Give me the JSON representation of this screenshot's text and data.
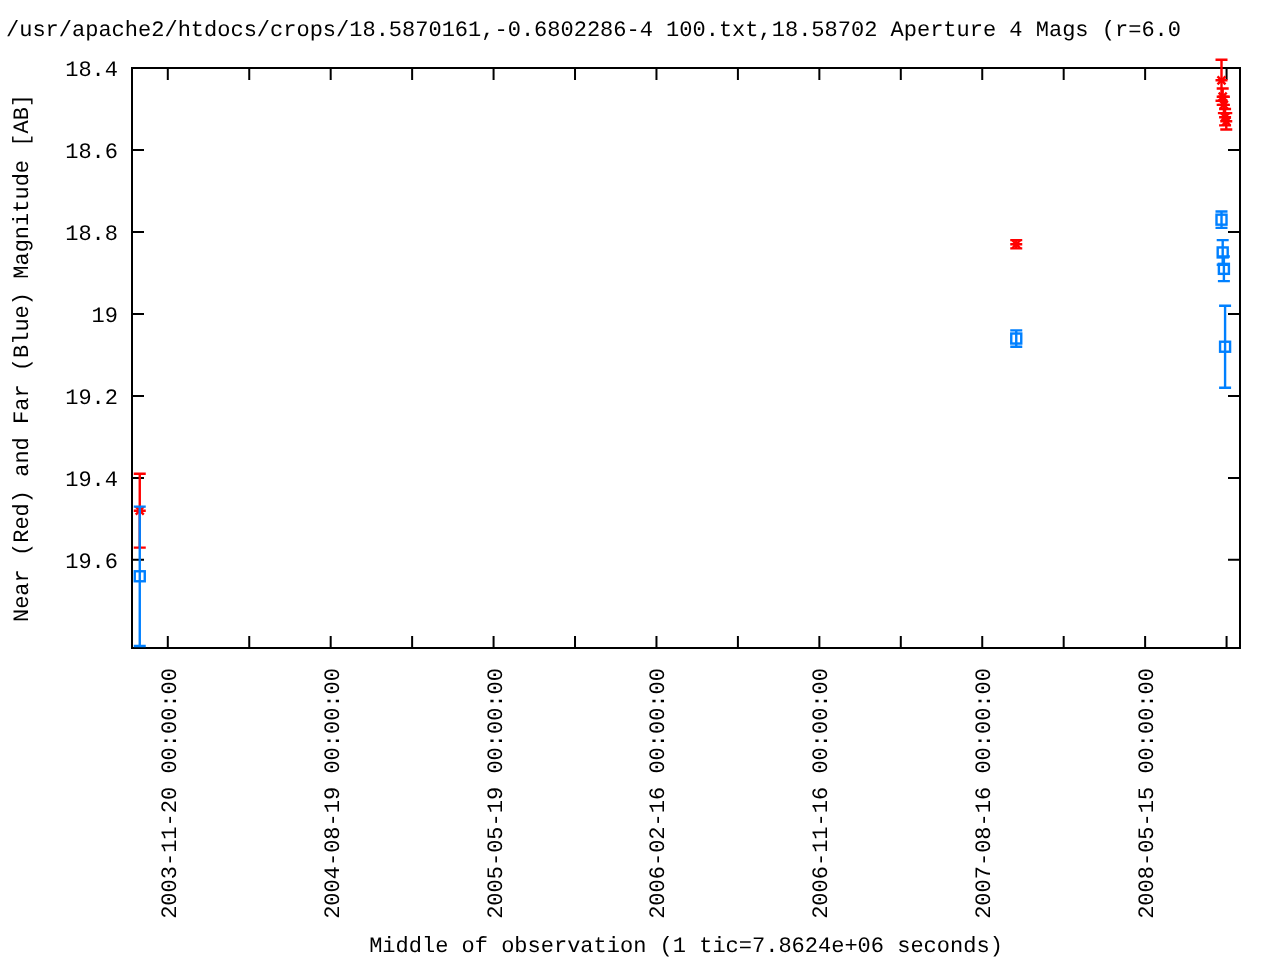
{
  "title": "/usr/apache2/htdocs/crops/18.5870161,-0.6802286-4 100.txt,18.58702   Aperture 4 Mags (r=6.0",
  "chart_data": {
    "type": "scatter",
    "xlabel": "Middle of observation (1 tic=7.8624e+06 seconds)",
    "ylabel": "Near (Red) and Far (Blue) Magnitude [AB]",
    "x": [
      "2003-10-04",
      "2007-10-12",
      "2008-09-20",
      "2008-09-22",
      "2008-09-24",
      "2008-09-26",
      "2008-09-28"
    ],
    "xlim": [
      "2003-09-21",
      "2008-10-21"
    ],
    "ylim": [
      19.815,
      18.4
    ],
    "xticks": [
      {
        "value": "2003-11-20",
        "label": "2003-11-20 00:00:00"
      },
      {
        "value": "2004-08-19",
        "label": "2004-08-19 00:00:00"
      },
      {
        "value": "2005-05-19",
        "label": "2005-05-19 00:00:00"
      },
      {
        "value": "2006-02-16",
        "label": "2006-02-16 00:00:00"
      },
      {
        "value": "2006-11-16",
        "label": "2006-11-16 00:00:00"
      },
      {
        "value": "2007-08-16",
        "label": "2007-08-16 00:00:00"
      },
      {
        "value": "2008-05-15",
        "label": "2008-05-15 00:00:00"
      }
    ],
    "yticks": [
      {
        "value": 18.4,
        "label": "18.4"
      },
      {
        "value": 18.6,
        "label": "18.6"
      },
      {
        "value": 18.8,
        "label": "18.8"
      },
      {
        "value": 19,
        "label": "19"
      },
      {
        "value": 19.2,
        "label": "19.2"
      },
      {
        "value": 19.4,
        "label": "19.4"
      },
      {
        "value": 19.6,
        "label": "19.6"
      }
    ],
    "series": [
      {
        "color": "#ff0000",
        "marker": "cross",
        "values": [
          19.48,
          18.83,
          18.43,
          18.47,
          18.49,
          18.52,
          18.53
        ],
        "errors": [
          0.09,
          0.01,
          0.05,
          0.02,
          0.02,
          0.02,
          0.02
        ]
      },
      {
        "color": "#0080ff",
        "marker": "square",
        "values": [
          19.64,
          19.06,
          18.77,
          18.85,
          18.89,
          19.08,
          null
        ],
        "errors": [
          0.17,
          0.02,
          0.02,
          0.03,
          0.03,
          0.1,
          null
        ]
      }
    ]
  }
}
